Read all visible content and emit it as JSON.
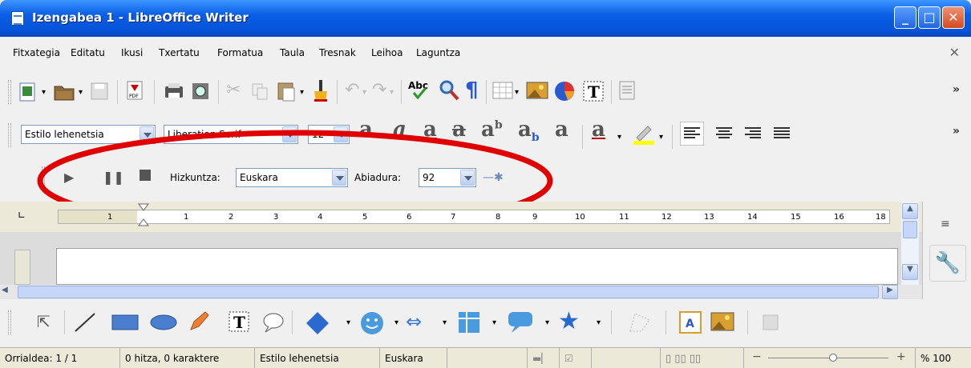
{
  "window": {
    "title": "Izengabea 1 - LibreOffice Writer",
    "minimize": "_",
    "maximize": "□",
    "close": "✕"
  },
  "menu": {
    "items": [
      "Fitxategia",
      "Editatu",
      "Ikusi",
      "Txertatu",
      "Formatua",
      "Taula",
      "Tresnak",
      "Leihoa",
      "Laguntza"
    ],
    "close": "✕"
  },
  "formatting": {
    "paragraph_style": "Estilo lehenetsia",
    "font_name": "Liberation Serif",
    "font_size": "12",
    "more": "»"
  },
  "standard_toolbar": {
    "more": "»"
  },
  "speech_toolbar": {
    "language_label": "Hizkuntza:",
    "language_value": "Euskara",
    "speed_label": "Abiadura:",
    "speed_value": "92"
  },
  "ruler": {
    "ticks": [
      "1",
      "1",
      "2",
      "3",
      "4",
      "5",
      "6",
      "7",
      "8",
      "9",
      "10",
      "11",
      "12",
      "13",
      "14",
      "15",
      "16",
      "18"
    ]
  },
  "status": {
    "page": "Orrialdea: 1 / 1",
    "words": "0 hitza, 0 karaktere",
    "style": "Estilo lehenetsia",
    "language": "Euskara",
    "zoom": "% 100"
  },
  "colors": {
    "title_bar": "#0553d8",
    "annotation_circle": "#e00000",
    "highlight": "#ffff00",
    "font_color": "#c00000"
  }
}
